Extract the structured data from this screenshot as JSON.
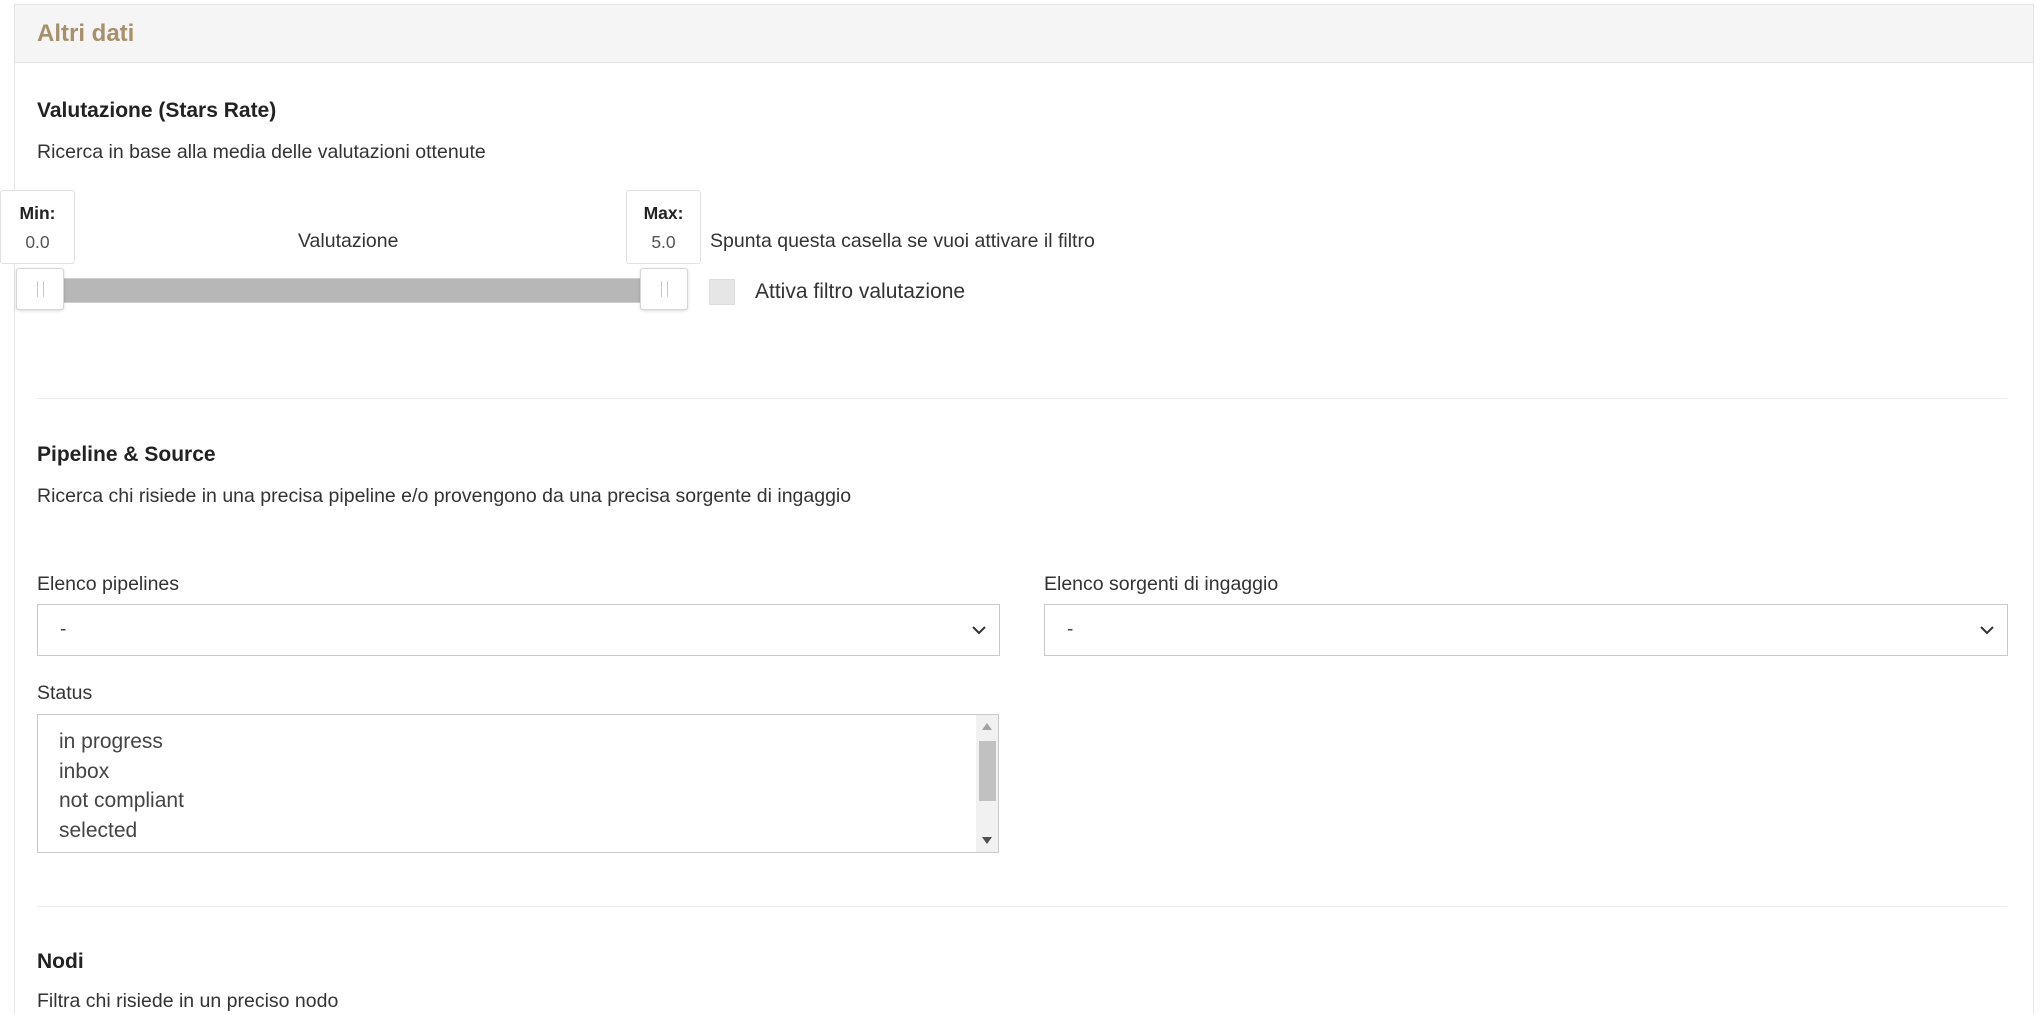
{
  "panel": {
    "title": "Altri dati"
  },
  "rating": {
    "heading": "Valutazione (Stars Rate)",
    "description": "Ricerca in base alla media delle valutazioni ottenute",
    "min_label": "Min:",
    "min_value": "0.0",
    "max_label": "Max:",
    "max_value": "5.0",
    "slider_label": "Valutazione",
    "slider_range": [
      0.0,
      5.0
    ],
    "filter_hint": "Spunta questa casella se vuoi attivare il filtro",
    "checkbox_label": "Attiva filtro valutazione",
    "checkbox_checked": false
  },
  "pipeline": {
    "heading": "Pipeline & Source",
    "description": "Ricerca chi risiede in una precisa pipeline e/o provengono da una precisa sorgente di ingaggio",
    "pipelines_label": "Elenco pipelines",
    "pipelines_value": "-",
    "sources_label": "Elenco sorgenti di ingaggio",
    "sources_value": "-",
    "status_label": "Status",
    "status_options": [
      "in progress",
      "inbox",
      "not compliant",
      "selected"
    ]
  },
  "nodes": {
    "heading": "Nodi",
    "description": "Filtra chi risiede in un preciso nodo"
  },
  "icons": {
    "select_arrow": "chevron-down-icon",
    "slider_grip": "grip-icon"
  }
}
